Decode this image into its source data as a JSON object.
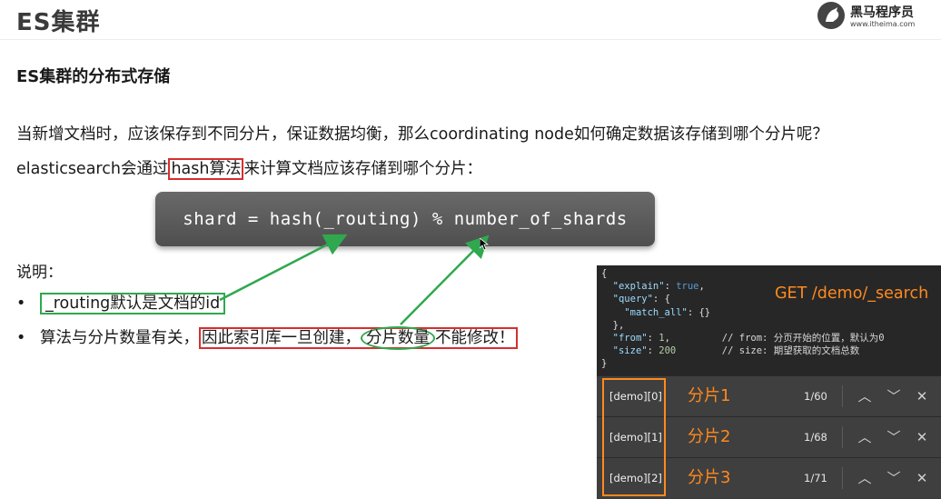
{
  "header": {
    "title": "ES集群",
    "logo_name": "黑马程序员",
    "logo_url": "www.itheima.com"
  },
  "section": {
    "heading": "ES集群的分布式存储"
  },
  "para1": "当新增文档时，应该保存到不同分片，保证数据均衡，那么coordinating node如何确定数据该存储到哪个分片呢？",
  "para2": {
    "before": "elasticsearch会通过",
    "highlight": "hash算法",
    "after": "来计算文档应该存储到哪个分片："
  },
  "formula": "shard = hash(_routing) % number_of_shards",
  "note": {
    "label": "说明：",
    "bullet1": "_routing默认是文档的id",
    "bullet2_before": "算法与分片数量有关，",
    "bullet2_box_start": "因此索引库一旦创建，",
    "bullet2_oval": "分片数量",
    "bullet2_box_end": "不能修改！"
  },
  "code": {
    "open": "{",
    "explain_key": "\"explain\"",
    "explain_val": "true",
    "query_key": "\"query\"",
    "match_all_key": "\"match_all\"",
    "from_key": "\"from\"",
    "from_val": "1",
    "from_comment": "// from: 分页开始的位置，默认为0",
    "size_key": "\"size\"",
    "size_val": "200",
    "size_comment": "// size: 期望获取的文档总数",
    "close": "}"
  },
  "request_label": "GET /demo/_search",
  "results": [
    {
      "index": "[demo][0]",
      "shard": "分片1",
      "count": "1/60"
    },
    {
      "index": "[demo][1]",
      "shard": "分片2",
      "count": "1/68"
    },
    {
      "index": "[demo][2]",
      "shard": "分片3",
      "count": "1/71"
    }
  ],
  "icons": {
    "up": "chevron-up-icon",
    "down": "chevron-down-icon",
    "close": "close-icon"
  },
  "colors": {
    "accent_orange": "#ff8a1e",
    "highlight_red": "#d62f2f",
    "highlight_green": "#2fa84f",
    "formula_bg": "#5a5a5a",
    "code_bg": "#272727"
  }
}
